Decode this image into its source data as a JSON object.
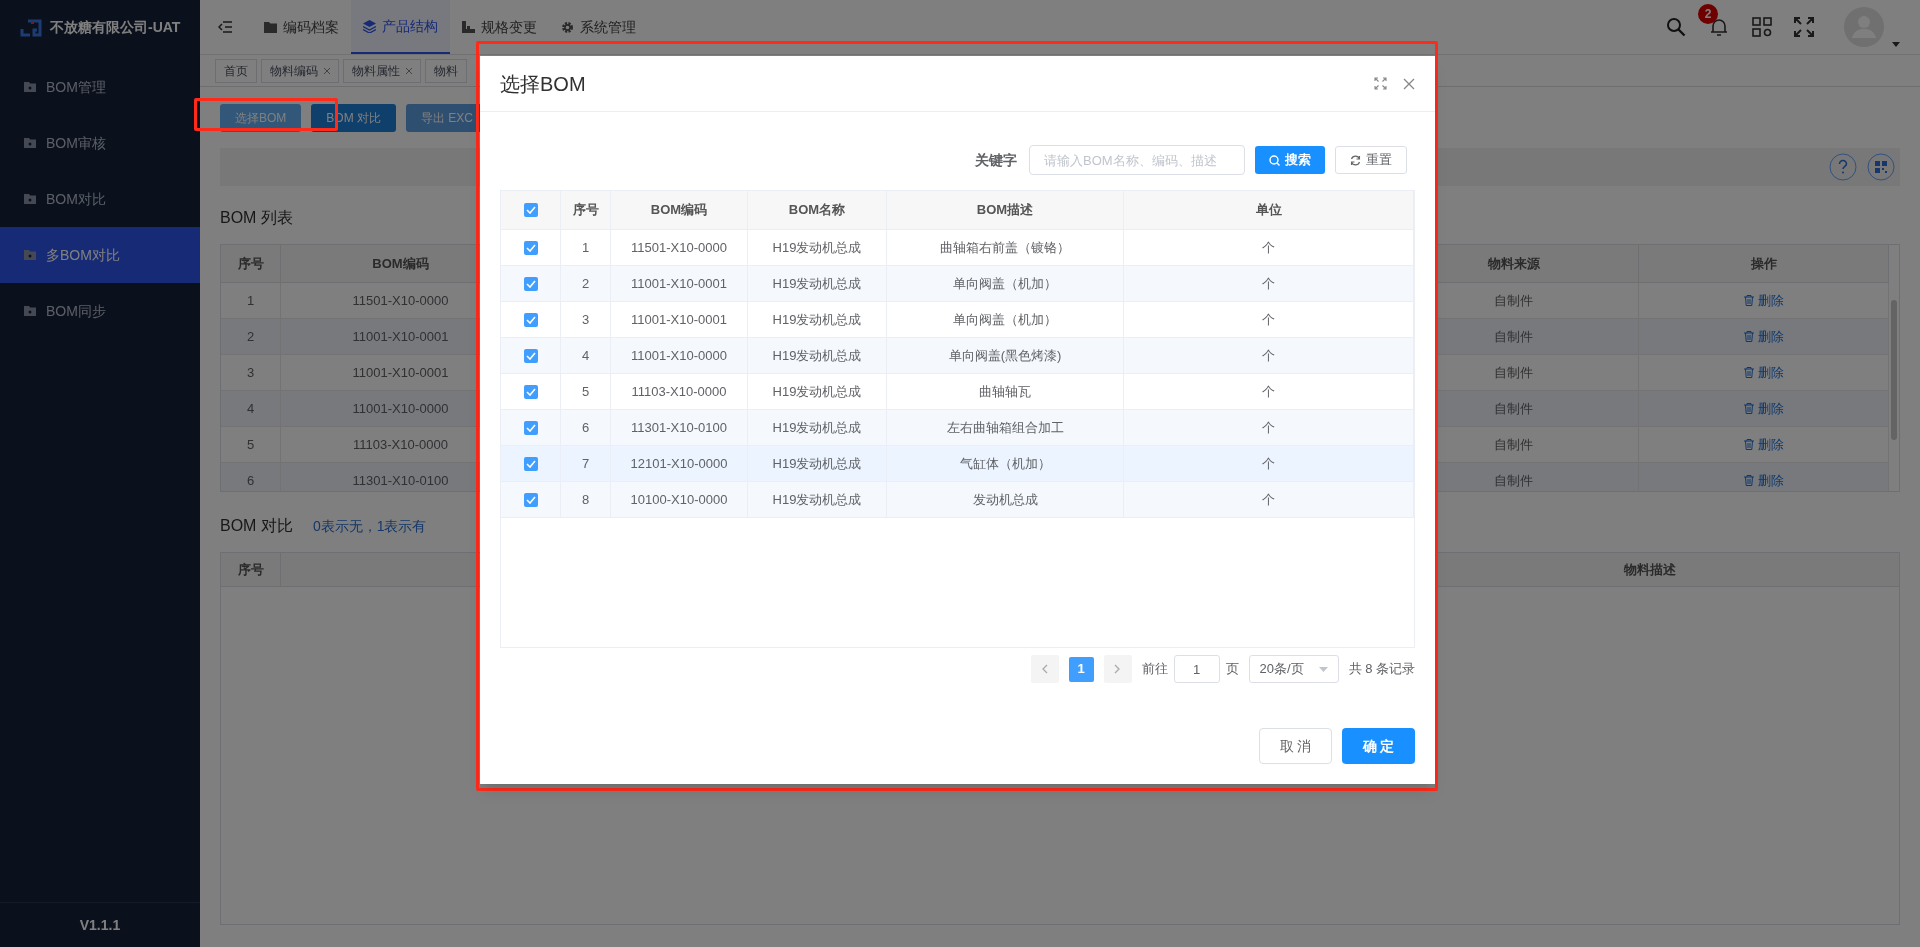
{
  "app": {
    "title": "不放糖有限公司-UAT",
    "version": "V1.1.1"
  },
  "sidebar": {
    "items": [
      {
        "label": "BOM管理",
        "selected": false
      },
      {
        "label": "BOM审核",
        "selected": false
      },
      {
        "label": "BOM对比",
        "selected": false
      },
      {
        "label": "多BOM对比",
        "selected": true
      },
      {
        "label": "BOM同步",
        "selected": false
      }
    ]
  },
  "top_nav": {
    "tabs": [
      {
        "label": "编码档案",
        "selected": false
      },
      {
        "label": "产品结构",
        "selected": true
      },
      {
        "label": "规格变更",
        "selected": false
      },
      {
        "label": "系统管理",
        "selected": false
      }
    ],
    "notification_count": "2"
  },
  "tag_bar": {
    "tags": [
      {
        "label": "首页",
        "closable": false
      },
      {
        "label": "物料编码",
        "closable": true
      },
      {
        "label": "物料属性",
        "closable": true
      },
      {
        "label": "物料",
        "closable": false
      }
    ]
  },
  "toolbar": {
    "buttons": [
      {
        "label": "选择BOM",
        "kind": "light"
      },
      {
        "label": "BOM 对比",
        "kind": "primary"
      },
      {
        "label": "导出 EXC",
        "kind": "disabled"
      }
    ]
  },
  "bom_list": {
    "title": "BOM 列表",
    "columns": [
      "序号",
      "BOM编码",
      "物料来源",
      "操作"
    ],
    "rows": [
      {
        "index": "1",
        "code": "11501-X10-0000",
        "source": "自制件",
        "action": "删除"
      },
      {
        "index": "2",
        "code": "11001-X10-0001",
        "source": "自制件",
        "action": "删除"
      },
      {
        "index": "3",
        "code": "11001-X10-0001",
        "source": "自制件",
        "action": "删除"
      },
      {
        "index": "4",
        "code": "11001-X10-0000",
        "source": "自制件",
        "action": "删除"
      },
      {
        "index": "5",
        "code": "11103-X10-0000",
        "source": "自制件",
        "action": "删除"
      },
      {
        "index": "6",
        "code": "11301-X10-0100",
        "source": "自制件",
        "action": "删除"
      }
    ]
  },
  "bom_compare": {
    "title": "BOM 对比",
    "hint": "0表示无，1表示有",
    "columns": [
      "序号",
      "物料描述"
    ]
  },
  "dialog": {
    "title": "选择BOM",
    "search": {
      "label": "关键字",
      "placeholder": "请输入BOM名称、编码、描述",
      "search_button": "搜索",
      "reset_button": "重置"
    },
    "table": {
      "all_checked": true,
      "columns": [
        "序号",
        "BOM编码",
        "BOM名称",
        "BOM描述",
        "单位"
      ],
      "rows": [
        {
          "checked": true,
          "hovered": false,
          "index": "1",
          "code": "11501-X10-0000",
          "name": "H19发动机总成",
          "description": "曲轴箱右前盖（镀铬）",
          "unit": "个"
        },
        {
          "checked": true,
          "hovered": false,
          "index": "2",
          "code": "11001-X10-0001",
          "name": "H19发动机总成",
          "description": "单向阀盖（机加）",
          "unit": "个"
        },
        {
          "checked": true,
          "hovered": false,
          "index": "3",
          "code": "11001-X10-0001",
          "name": "H19发动机总成",
          "description": "单向阀盖（机加）",
          "unit": "个"
        },
        {
          "checked": true,
          "hovered": false,
          "index": "4",
          "code": "11001-X10-0000",
          "name": "H19发动机总成",
          "description": "单向阀盖(黑色烤漆)",
          "unit": "个"
        },
        {
          "checked": true,
          "hovered": false,
          "index": "5",
          "code": "11103-X10-0000",
          "name": "H19发动机总成",
          "description": "曲轴轴瓦",
          "unit": "个"
        },
        {
          "checked": true,
          "hovered": false,
          "index": "6",
          "code": "11301-X10-0100",
          "name": "H19发动机总成",
          "description": "左右曲轴箱组合加工",
          "unit": "个"
        },
        {
          "checked": true,
          "hovered": true,
          "index": "7",
          "code": "12101-X10-0000",
          "name": "H19发动机总成",
          "description": "气缸体（机加）",
          "unit": "个"
        },
        {
          "checked": true,
          "hovered": false,
          "index": "8",
          "code": "10100-X10-0000",
          "name": "H19发动机总成",
          "description": "发动机总成",
          "unit": "个"
        }
      ]
    },
    "pagination": {
      "pages": [
        {
          "label": "1",
          "selected": true
        }
      ],
      "goto_label": "前往",
      "goto_value": "1",
      "page_suffix": "页",
      "page_size": "20条/页",
      "total": "共 8 条记录"
    },
    "buttons": {
      "cancel": "取 消",
      "confirm": "确 定"
    }
  }
}
